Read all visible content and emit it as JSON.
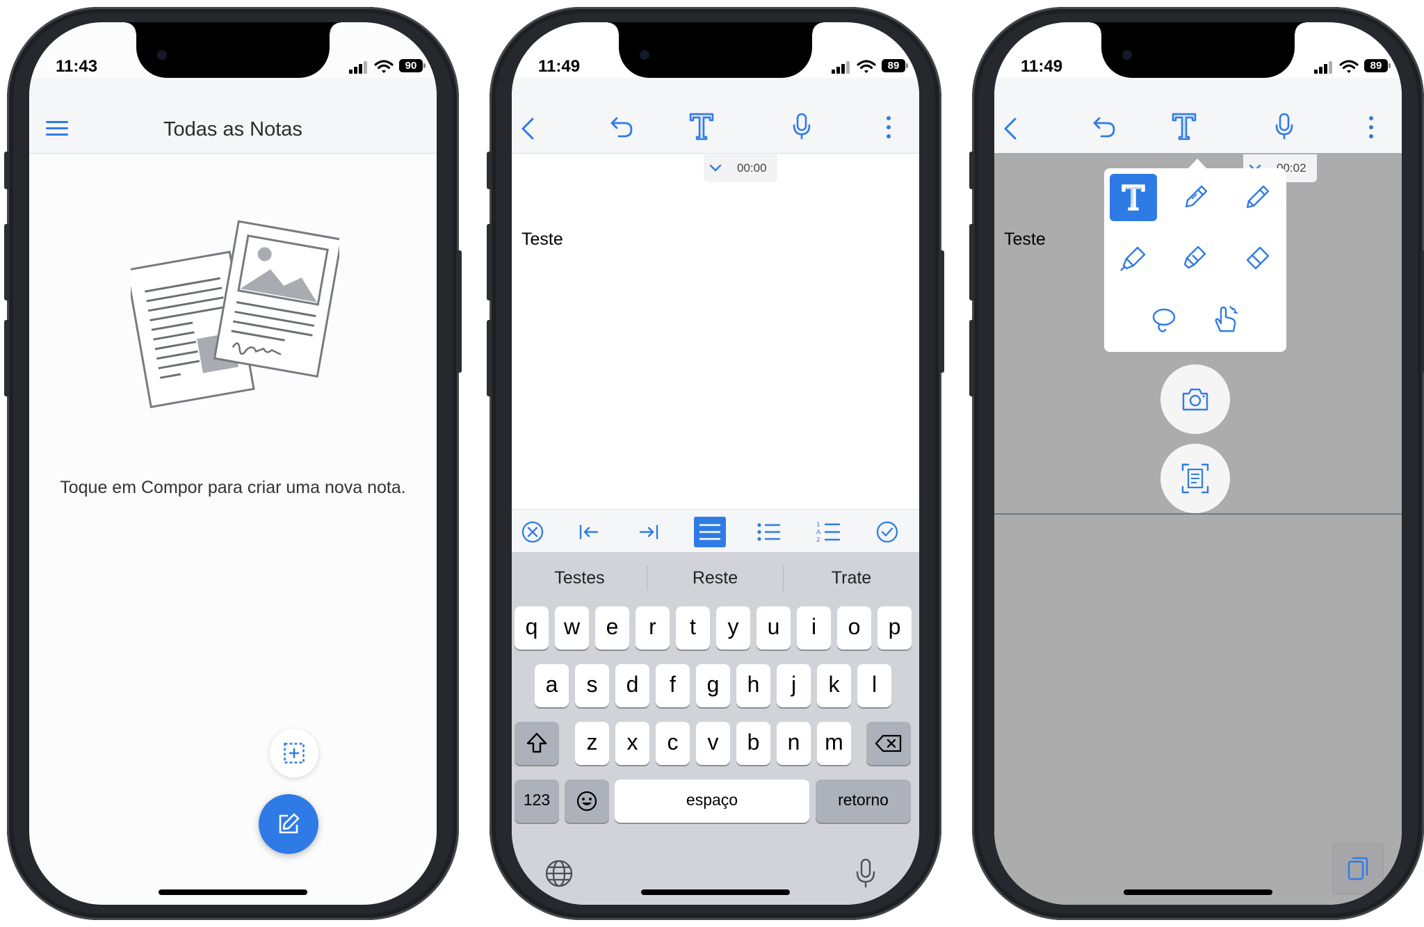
{
  "phone1": {
    "time": "11:43",
    "battery": "90",
    "title": "Todas as Notas",
    "empty_message": "Toque em Compor para criar uma nova nota.",
    "icons": [
      "menu-icon",
      "documents-illustration",
      "add-frame-icon",
      "compose-icon"
    ]
  },
  "phone2": {
    "time": "11:49",
    "battery": "89",
    "recording_time": "00:00",
    "note_text": "Teste",
    "suggestions": [
      "Testes",
      "Reste",
      "Trate"
    ],
    "keyboard": {
      "row1": [
        "q",
        "w",
        "e",
        "r",
        "t",
        "y",
        "u",
        "i",
        "o",
        "p"
      ],
      "row2": [
        "a",
        "s",
        "d",
        "f",
        "g",
        "h",
        "j",
        "k",
        "l"
      ],
      "row3": [
        "z",
        "x",
        "c",
        "v",
        "b",
        "n",
        "m"
      ],
      "numbers": "123",
      "space": "espaço",
      "return": "retorno"
    }
  },
  "phone3": {
    "time": "11:49",
    "battery": "89",
    "recording_time": "00:02",
    "note_text": "Teste"
  },
  "colors": {
    "accent": "#2f7be6",
    "toolbar_bg": "#f5f6f8",
    "keyboard_bg": "#d1d3d9",
    "overlay_gray": "#acacac"
  }
}
